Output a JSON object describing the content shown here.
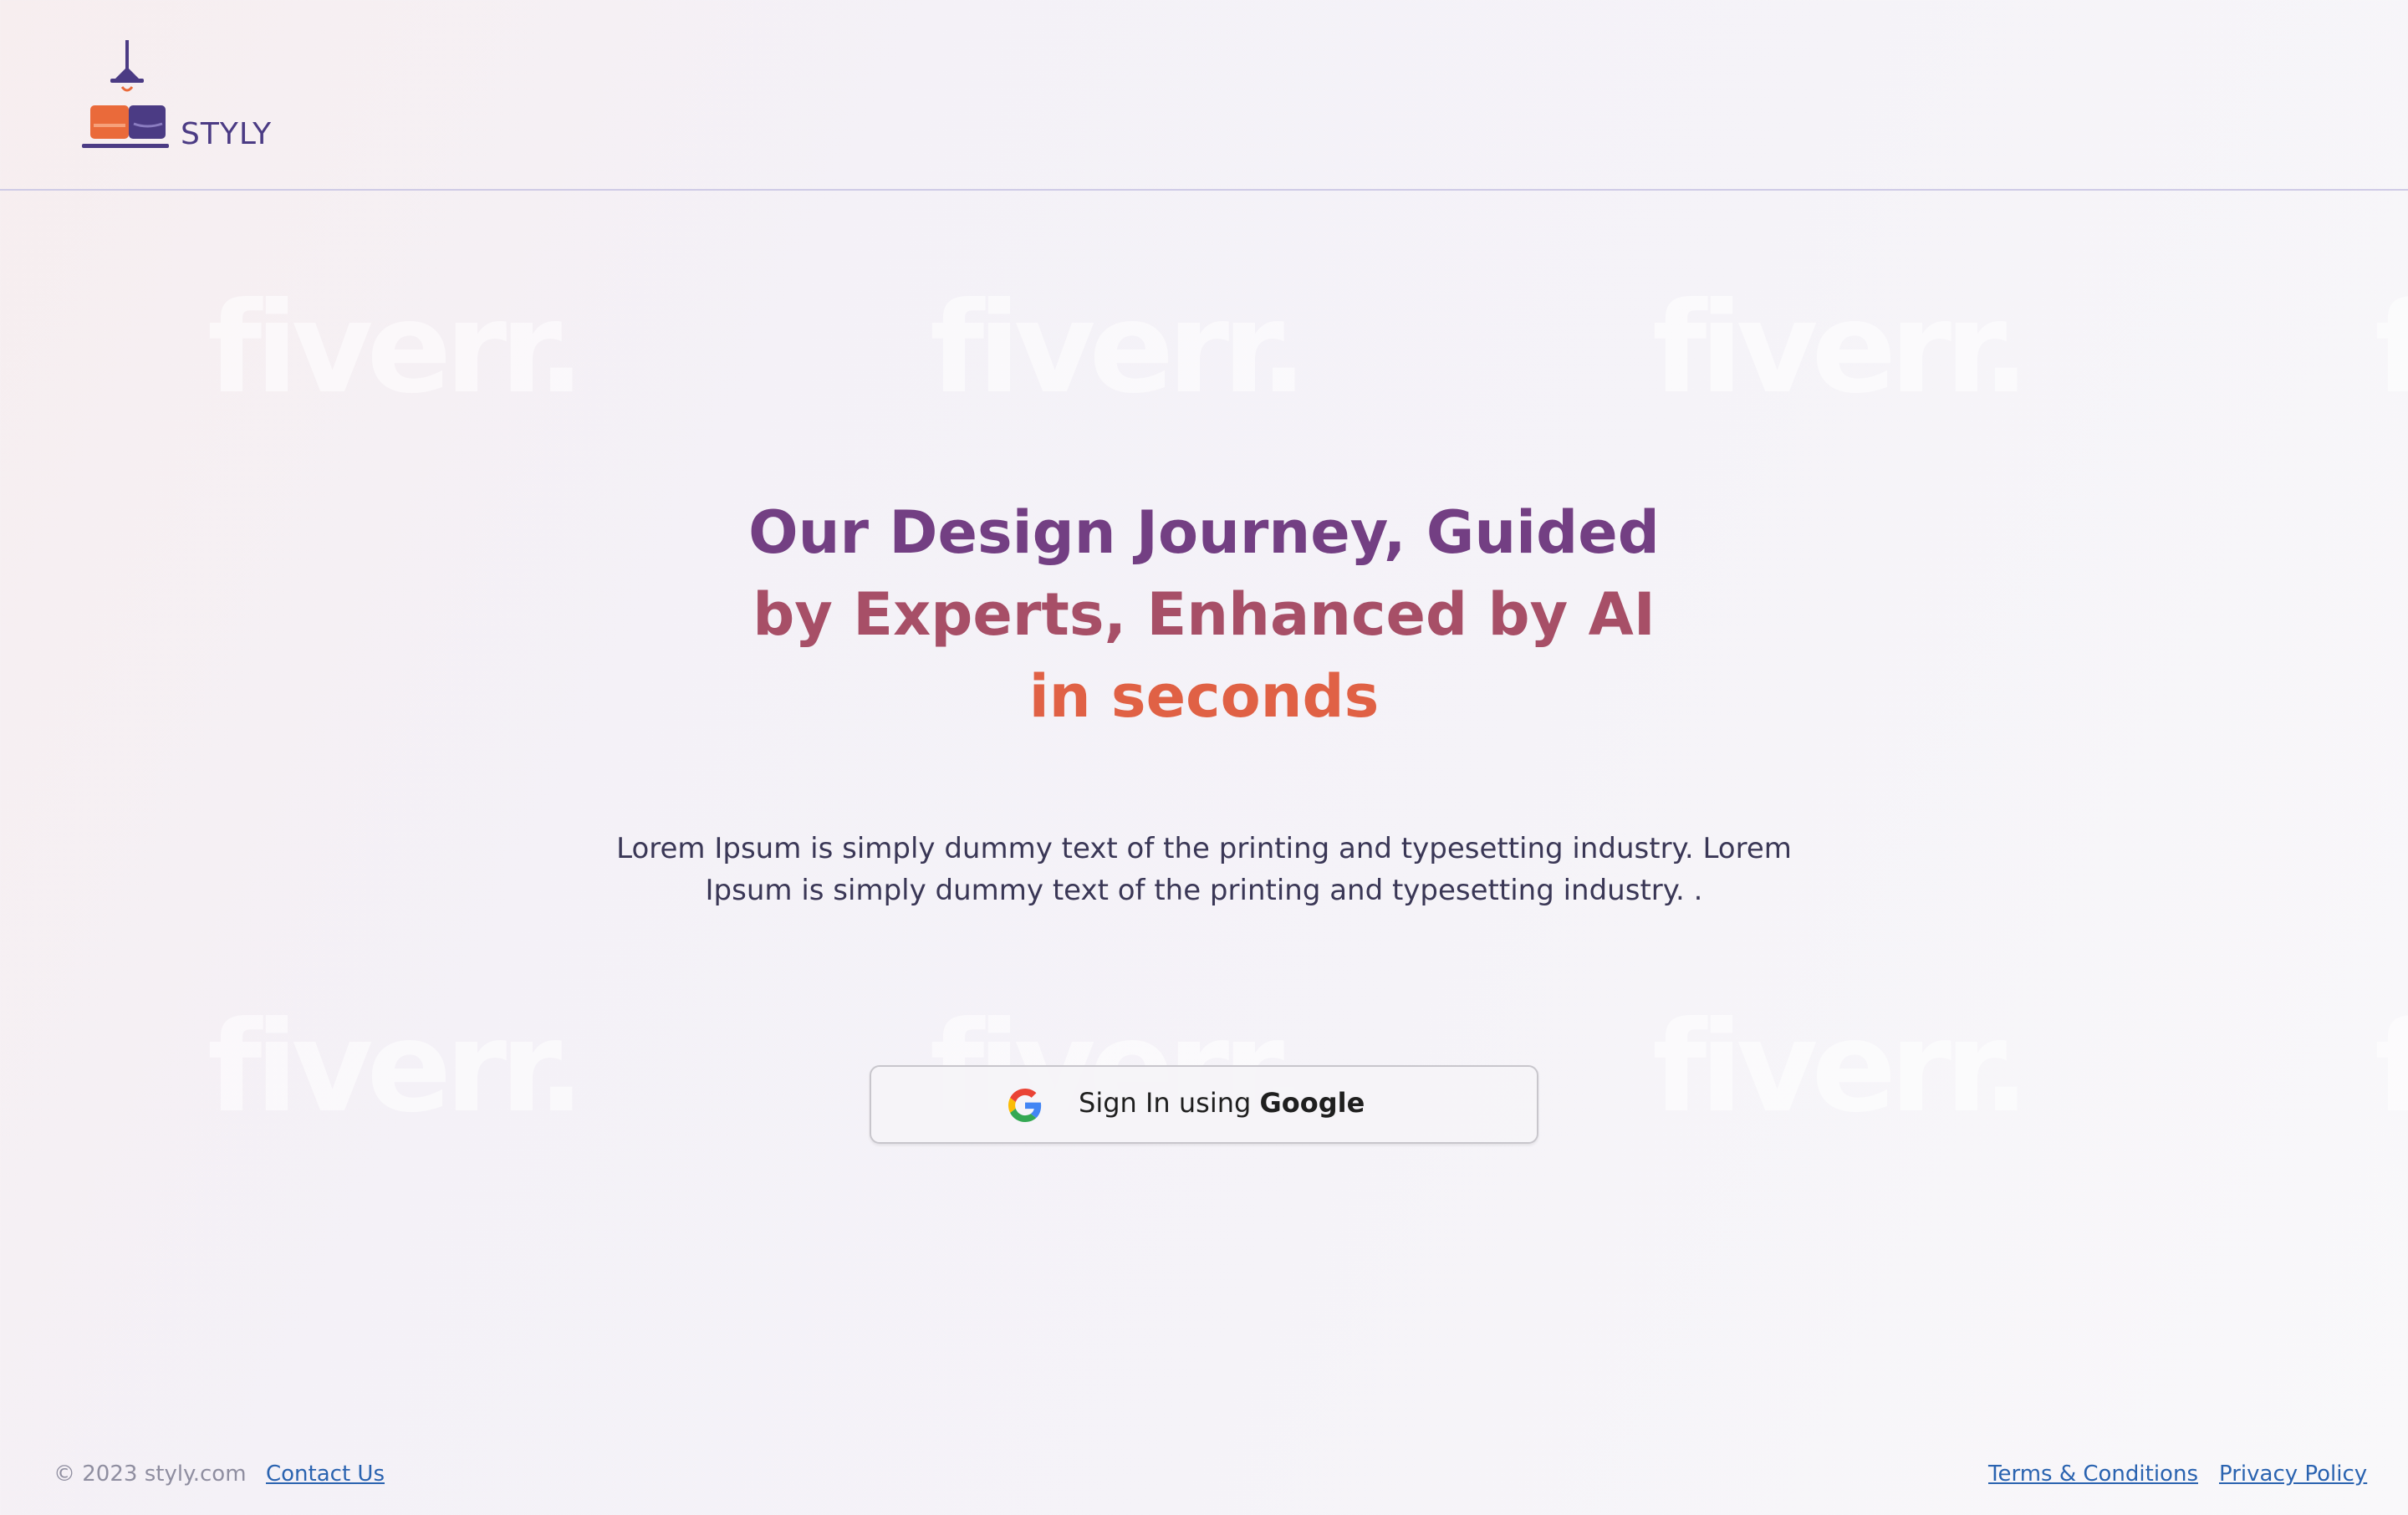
{
  "brand": {
    "name": "STYLY",
    "logo_icon": "lamp-sofa-logo",
    "colors": {
      "purple": "#4b3b84",
      "orange": "#ea6a3a"
    }
  },
  "watermarks": [
    "fiverr.",
    "fiverr.",
    "fiverr.",
    "fiverr.",
    "fiverr.",
    "fiverr.",
    "fiverr.",
    "fiverr."
  ],
  "hero": {
    "title_line1": "Our Design Journey, Guided",
    "title_line2": "by Experts, Enhanced by AI",
    "title_line3": "in seconds",
    "description": "Lorem Ipsum is simply dummy text of the printing and typesetting industry. Lorem Ipsum is simply dummy text of the printing and typesetting industry. .",
    "colors": {
      "line1": "#733f83",
      "line2": "#a74f67",
      "line3": "#e06145"
    }
  },
  "signin": {
    "label_prefix": "Sign In using",
    "label_provider": "Google",
    "icon": "google-g-icon"
  },
  "footer": {
    "copyright": "© 2023 styly.com",
    "contact_label": "Contact Us",
    "terms_label": "Terms & Conditions",
    "privacy_label": "Privacy Policy",
    "link_color": "#2a63b0"
  }
}
